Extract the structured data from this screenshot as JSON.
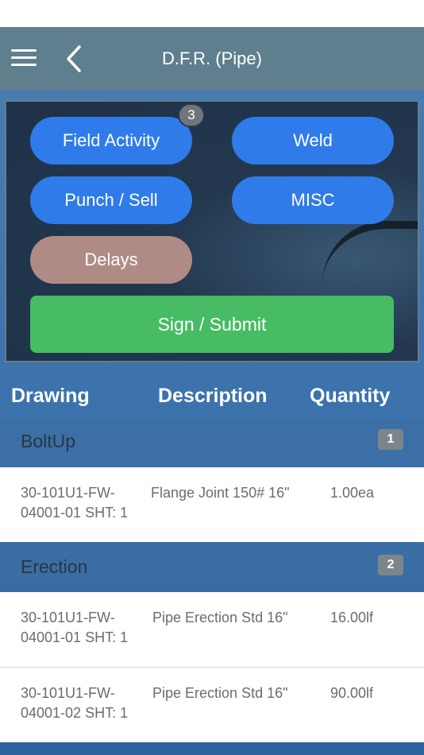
{
  "nav": {
    "title": "D.F.R. (Pipe)",
    "menu_icon": "hamburger-icon",
    "back_icon": "chevron-left-icon"
  },
  "actions": {
    "field_activity": {
      "label": "Field Activity",
      "badge": "3"
    },
    "weld": "Weld",
    "punch_sell": "Punch / Sell",
    "misc": "MISC",
    "delays": "Delays",
    "submit": "Sign / Submit"
  },
  "colors": {
    "nav_bg": "#5f7f8e",
    "blue_button": "#2f7bea",
    "delays_button": "#b08b86",
    "submit_button": "#47bc64"
  },
  "columns": [
    "Drawing",
    "Description",
    "Quantity"
  ],
  "sections": [
    {
      "name": "BoltUp",
      "count": "1",
      "rows": [
        {
          "drawing_line1": "30-101U1-FW-",
          "drawing_line2": "04001-01 SHT: 1",
          "description": "Flange Joint 150# 16\"",
          "quantity": "1.00ea"
        }
      ]
    },
    {
      "name": "Erection",
      "count": "2",
      "rows": [
        {
          "drawing_line1": "30-101U1-FW-",
          "drawing_line2": "04001-01 SHT: 1",
          "description": "Pipe Erection Std 16\"",
          "quantity": "16.00lf"
        },
        {
          "drawing_line1": "30-101U1-FW-",
          "drawing_line2": "04001-02 SHT: 1",
          "description": "Pipe Erection Std 16\"",
          "quantity": "90.00lf"
        }
      ]
    }
  ]
}
